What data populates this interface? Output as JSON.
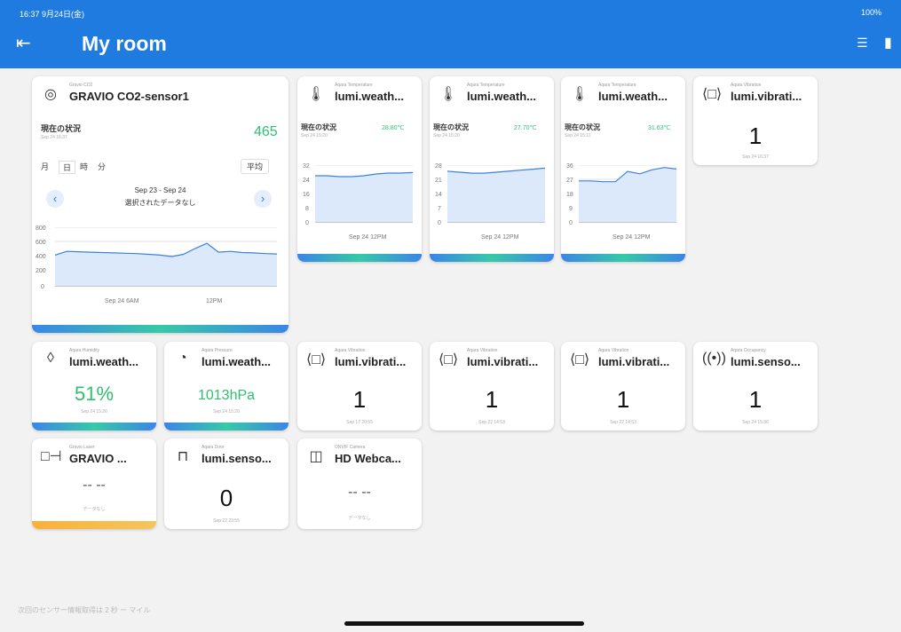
{
  "status": {
    "time": "16:37 9月24日(金)",
    "right": "100%"
  },
  "header": {
    "back_icon": "back-icon",
    "title": "My room",
    "icon1": "list-icon",
    "icon2": "menu-icon"
  },
  "co2": {
    "type": "Gravio CO2",
    "name": "GRAVIO CO2-sensor1",
    "state_label": "現在の状況",
    "state_date": "Sep 24 16:37",
    "value": "465",
    "segments": [
      "月",
      "日",
      "時",
      "分"
    ],
    "avg_label": "平均",
    "range": "Sep 23 - Sep 24",
    "no_data": "選択されたデータなし",
    "yticks": [
      "800",
      "600",
      "400",
      "200",
      "0"
    ],
    "xticks": [
      "Sep 24 6AM",
      "12PM"
    ],
    "chart_data": {
      "type": "line",
      "ylim": [
        0,
        800
      ],
      "values": [
        420,
        470,
        465,
        460,
        455,
        450,
        445,
        440,
        430,
        420,
        400,
        430,
        510,
        580,
        460,
        470,
        455,
        450,
        440,
        435
      ]
    }
  },
  "temps": [
    {
      "type": "Aqara Temperature",
      "name": "lumi.weath...",
      "state_label": "現在の状況",
      "state_date": "Sep 24 15:20",
      "value": "28.80℃",
      "yticks": [
        "32",
        "24",
        "16",
        "8",
        "0"
      ],
      "xtick": "Sep 24 12PM",
      "chart_data": {
        "type": "line",
        "ylim": [
          0,
          32
        ],
        "values": [
          26,
          26,
          25.5,
          25.5,
          26,
          27,
          27.5,
          27.5,
          27.8
        ]
      }
    },
    {
      "type": "Aqara Temperature",
      "name": "lumi.weath...",
      "state_label": "現在の状況",
      "state_date": "Sep 24 15:20",
      "value": "27.70℃",
      "yticks": [
        "28",
        "21",
        "14",
        "7",
        "0"
      ],
      "xtick": "Sep 24 12PM",
      "chart_data": {
        "type": "line",
        "ylim": [
          0,
          28
        ],
        "values": [
          25,
          24.5,
          24,
          24,
          24.5,
          25,
          25.5,
          26,
          26.5
        ]
      }
    },
    {
      "type": "Aqara Temperature",
      "name": "lumi.weath...",
      "state_label": "現在の状況",
      "state_date": "Sep 24 15:11",
      "value": "31.63℃",
      "yticks": [
        "36",
        "27",
        "18",
        "9",
        "0"
      ],
      "xtick": "Sep 24 12PM",
      "chart_data": {
        "type": "line",
        "ylim": [
          0,
          36
        ],
        "values": [
          26,
          26,
          25.5,
          25.5,
          32,
          30.5,
          33,
          34.5,
          33.5
        ]
      }
    }
  ],
  "vib_top": {
    "type": "Aqara Vibration",
    "name": "lumi.vibrati...",
    "value": "1",
    "date": "Sep 24 16:37"
  },
  "humid": {
    "type": "Aqara Humidity",
    "name": "lumi.weath...",
    "value": "51%",
    "date": "Sep 24 15:20"
  },
  "press": {
    "type": "Aqara Pressure",
    "name": "lumi.weath...",
    "value": "1013hPa",
    "date": "Sep 24 15:20"
  },
  "vibs": [
    {
      "type": "Aqara Vibration",
      "name": "lumi.vibrati...",
      "value": "1",
      "date": "Sep 17 20:55"
    },
    {
      "type": "Aqara Vibration",
      "name": "lumi.vibrati...",
      "value": "1",
      "date": "Sep 22 14:53"
    },
    {
      "type": "Aqara Vibration",
      "name": "lumi.vibrati...",
      "value": "1",
      "date": "Sep 22 14:53"
    }
  ],
  "occ": {
    "type": "Aqara Occupancy",
    "name": "lumi.senso...",
    "value": "1",
    "date": "Sep 24 15:36"
  },
  "laser": {
    "type": "Gravio Laser",
    "name": "GRAVIO ...",
    "value": "-- --",
    "no_data": "データなし"
  },
  "door": {
    "type": "Aqara Door",
    "name": "lumi.senso...",
    "value": "0",
    "date": "Sep 22 23:55"
  },
  "cam": {
    "type": "ONVIF Camera",
    "name": "HD Webca...",
    "value": "-- --",
    "no_data": "データなし"
  },
  "footer": "次回のセンサー情報取得は 2 秒 ー マイル"
}
